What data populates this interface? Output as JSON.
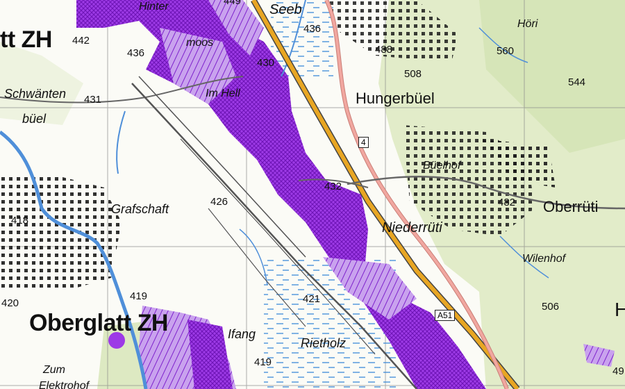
{
  "map": {
    "places": {
      "oberglatt": "Oberglatt ZH",
      "oberglatt_edge": "tt ZH",
      "hungerbuel": "Hungerbüel",
      "oberruti": "Oberrüti",
      "niederruti": "Niederrüti",
      "seeb": "Seeb",
      "grafschaft": "Grafschaft",
      "rietholz": "Rietholz",
      "ifang": "Ifang",
      "buelhof": "Büelhof",
      "wilenhof": "Wilenhof",
      "hori": "Höri",
      "im_hell": "Im Hell",
      "schwanten": "Schwänten",
      "buel": "büel",
      "hinter": "Hinter",
      "moos": "moos",
      "zum": "Zum",
      "elektrohof": "Elektrohof",
      "h_edge": "H"
    },
    "roads": {
      "a51": "A51",
      "r4": "4"
    },
    "spot_heights": {
      "h442": "442",
      "h436a": "436",
      "h431": "431",
      "h430": "430",
      "h436b": "436",
      "h488": "488",
      "h508": "508",
      "h560": "560",
      "h544": "544",
      "h432": "432",
      "h426": "426",
      "h418": "418",
      "h482": "482",
      "h421": "421",
      "h419a": "419",
      "h420": "420",
      "h419b": "419",
      "h506": "506",
      "h449": "449",
      "h49x": "49"
    },
    "colors": {
      "paper": "#fbfbf6",
      "forest": "#e2ecc9",
      "nature_reserve": "#9b35e0",
      "highway": "#e8a623",
      "main_road": "#f1a7a0",
      "river": "#4f8fd9",
      "railway": "#555555",
      "grid": "#888888"
    }
  }
}
